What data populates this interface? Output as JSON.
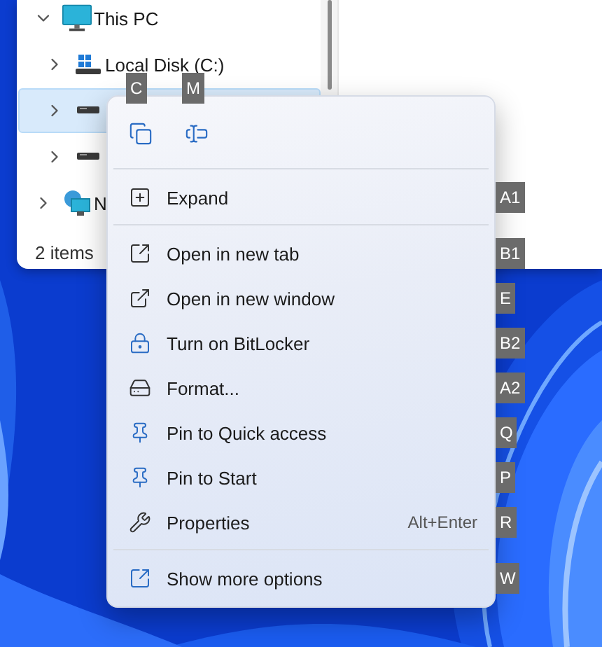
{
  "explorer": {
    "tree": [
      {
        "label": "This PC",
        "kind": "computer",
        "expanded": true,
        "selected": false,
        "children": [
          {
            "label": "Local Disk (C:)",
            "kind": "system-drive",
            "expanded": false,
            "selected": false
          },
          {
            "kind": "drive",
            "expanded": false,
            "selected": true
          },
          {
            "kind": "drive",
            "expanded": false,
            "selected": false
          }
        ]
      },
      {
        "label": "N",
        "kind": "network",
        "expanded": false,
        "selected": false
      }
    ],
    "status_bar": "2 items"
  },
  "context_menu": {
    "quick_actions": [
      {
        "kind": "copy",
        "key": "C"
      },
      {
        "kind": "rename",
        "key": "M"
      }
    ],
    "sections": [
      [
        {
          "kind": "expand",
          "label": "Expand",
          "key": "A1"
        }
      ],
      [
        {
          "kind": "new-tab",
          "label": "Open in new tab",
          "key": "B1"
        },
        {
          "kind": "new-window",
          "label": "Open in new window",
          "key": "E"
        },
        {
          "kind": "bitlocker",
          "label": "Turn on BitLocker",
          "key": "B2"
        },
        {
          "kind": "format",
          "label": "Format...",
          "key": "A2"
        },
        {
          "kind": "pin",
          "label": "Pin to Quick access",
          "key": "Q"
        },
        {
          "kind": "pin",
          "label": "Pin to Start",
          "key": "P"
        },
        {
          "kind": "properties",
          "label": "Properties",
          "shortcut": "Alt+Enter",
          "key": "R"
        }
      ],
      [
        {
          "kind": "more",
          "label": "Show more options",
          "key": "W"
        }
      ]
    ]
  }
}
